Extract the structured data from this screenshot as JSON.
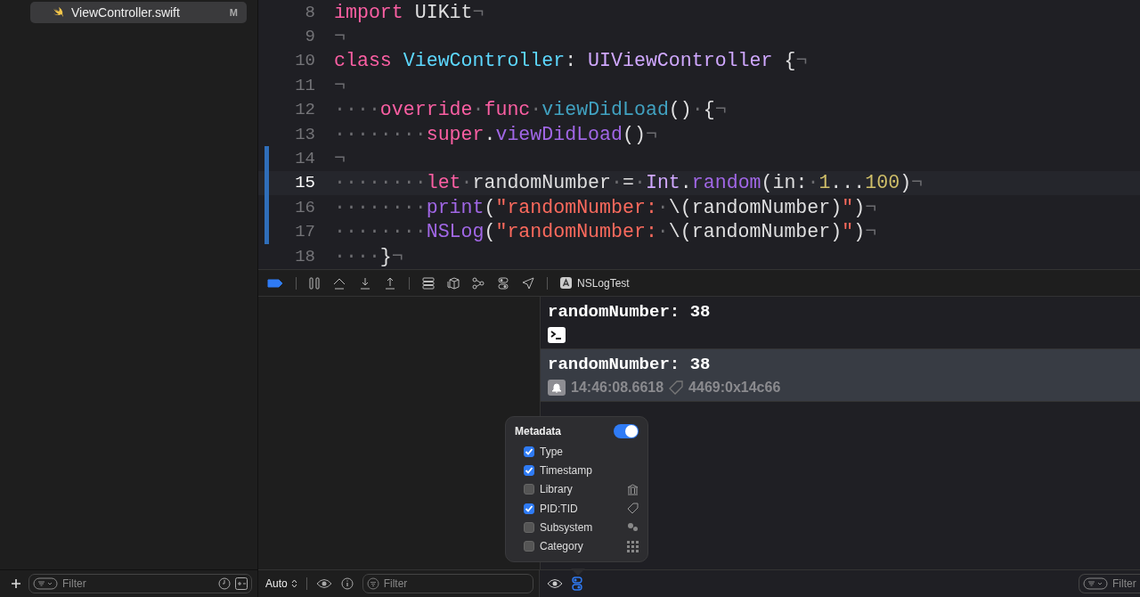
{
  "navigator": {
    "file": {
      "name": "ViewController.swift",
      "badge": "M",
      "selected": true
    },
    "filter": {
      "placeholder": "Filter"
    }
  },
  "editor": {
    "lines": [
      {
        "number": "8",
        "current": false,
        "changed": false,
        "tokens": [
          {
            "kind": "keyword",
            "text": "import"
          },
          {
            "kind": "plain",
            "text": " UIKit"
          },
          {
            "kind": "invisible",
            "text": "¬"
          }
        ]
      },
      {
        "number": "9",
        "current": false,
        "changed": false,
        "tokens": [
          {
            "kind": "invisible",
            "text": "¬"
          }
        ]
      },
      {
        "number": "10",
        "current": false,
        "changed": false,
        "tokens": [
          {
            "kind": "keyword",
            "text": "class"
          },
          {
            "kind": "decl",
            "text": " ViewController"
          },
          {
            "kind": "plain",
            "text": ": "
          },
          {
            "kind": "type",
            "text": "UIViewController"
          },
          {
            "kind": "plain",
            "text": " {"
          },
          {
            "kind": "invisible",
            "text": "¬"
          }
        ]
      },
      {
        "number": "11",
        "current": false,
        "changed": false,
        "tokens": [
          {
            "kind": "invisible",
            "text": "¬"
          }
        ]
      },
      {
        "number": "12",
        "current": false,
        "changed": false,
        "tokens": [
          {
            "kind": "invisible",
            "text": "····"
          },
          {
            "kind": "keyword",
            "text": "override"
          },
          {
            "kind": "invisible",
            "text": "·"
          },
          {
            "kind": "keyword",
            "text": "func"
          },
          {
            "kind": "invisible",
            "text": "·"
          },
          {
            "kind": "declfunc",
            "text": "viewDidLoad"
          },
          {
            "kind": "plain",
            "text": "()"
          },
          {
            "kind": "invisible",
            "text": "·"
          },
          {
            "kind": "plain",
            "text": "{"
          },
          {
            "kind": "invisible",
            "text": "¬"
          }
        ]
      },
      {
        "number": "13",
        "current": false,
        "changed": false,
        "tokens": [
          {
            "kind": "invisible",
            "text": "········"
          },
          {
            "kind": "keyword",
            "text": "super"
          },
          {
            "kind": "plain",
            "text": "."
          },
          {
            "kind": "call",
            "text": "viewDidLoad"
          },
          {
            "kind": "plain",
            "text": "()"
          },
          {
            "kind": "invisible",
            "text": "¬"
          }
        ]
      },
      {
        "number": "14",
        "current": false,
        "changed": true,
        "tokens": [
          {
            "kind": "invisible",
            "text": "¬"
          }
        ]
      },
      {
        "number": "15",
        "current": true,
        "changed": true,
        "tokens": [
          {
            "kind": "invisible",
            "text": "········"
          },
          {
            "kind": "keyword",
            "text": "let"
          },
          {
            "kind": "invisible",
            "text": "·"
          },
          {
            "kind": "plain",
            "text": "randomNumber"
          },
          {
            "kind": "invisible",
            "text": "·"
          },
          {
            "kind": "plain",
            "text": "="
          },
          {
            "kind": "invisible",
            "text": "·"
          },
          {
            "kind": "type",
            "text": "Int"
          },
          {
            "kind": "plain",
            "text": "."
          },
          {
            "kind": "call",
            "text": "random"
          },
          {
            "kind": "plain",
            "text": "(in:"
          },
          {
            "kind": "invisible",
            "text": "·"
          },
          {
            "kind": "number",
            "text": "1"
          },
          {
            "kind": "plain",
            "text": "..."
          },
          {
            "kind": "number",
            "text": "100"
          },
          {
            "kind": "plain",
            "text": ")"
          },
          {
            "kind": "invisible",
            "text": "¬"
          }
        ]
      },
      {
        "number": "16",
        "current": false,
        "changed": true,
        "tokens": [
          {
            "kind": "invisible",
            "text": "········"
          },
          {
            "kind": "call",
            "text": "print"
          },
          {
            "kind": "plain",
            "text": "("
          },
          {
            "kind": "string",
            "text": "\"randomNumber:"
          },
          {
            "kind": "invisible",
            "text": "·"
          },
          {
            "kind": "plain",
            "text": "\\(randomNumber)"
          },
          {
            "kind": "string",
            "text": "\""
          },
          {
            "kind": "plain",
            "text": ")"
          },
          {
            "kind": "invisible",
            "text": "¬"
          }
        ]
      },
      {
        "number": "17",
        "current": false,
        "changed": true,
        "tokens": [
          {
            "kind": "invisible",
            "text": "········"
          },
          {
            "kind": "call",
            "text": "NSLog"
          },
          {
            "kind": "plain",
            "text": "("
          },
          {
            "kind": "string",
            "text": "\"randomNumber:"
          },
          {
            "kind": "invisible",
            "text": "·"
          },
          {
            "kind": "plain",
            "text": "\\(randomNumber)"
          },
          {
            "kind": "string",
            "text": "\""
          },
          {
            "kind": "plain",
            "text": ")"
          },
          {
            "kind": "invisible",
            "text": "¬"
          }
        ]
      },
      {
        "number": "18",
        "current": false,
        "changed": false,
        "tokens": [
          {
            "kind": "invisible",
            "text": "····"
          },
          {
            "kind": "plain",
            "text": "}"
          },
          {
            "kind": "invisible",
            "text": "¬"
          }
        ]
      }
    ]
  },
  "debug_toolbar": {
    "breakpoints_active": true,
    "target": "NSLogTest"
  },
  "variables": {
    "scope": "Auto",
    "filter": {
      "placeholder": "Filter"
    }
  },
  "console": {
    "entries": [
      {
        "kind": "print",
        "message": "randomNumber: 38",
        "selected": false
      },
      {
        "kind": "nslog",
        "message": "randomNumber: 38",
        "selected": true,
        "timestamp": "14:46:08.6618",
        "pid_tid": "4469:0x14c66"
      }
    ],
    "filter": {
      "placeholder": "Filter"
    }
  },
  "metadata_popover": {
    "title": "Metadata",
    "on": true,
    "options": [
      {
        "label": "Type",
        "checked": true,
        "kind": "none"
      },
      {
        "label": "Timestamp",
        "checked": true,
        "kind": "none"
      },
      {
        "label": "Library",
        "checked": false,
        "kind": "library"
      },
      {
        "label": "PID:TID",
        "checked": true,
        "kind": "tag"
      },
      {
        "label": "Subsystem",
        "checked": false,
        "kind": "gears"
      },
      {
        "label": "Category",
        "checked": false,
        "kind": "grid"
      }
    ]
  }
}
